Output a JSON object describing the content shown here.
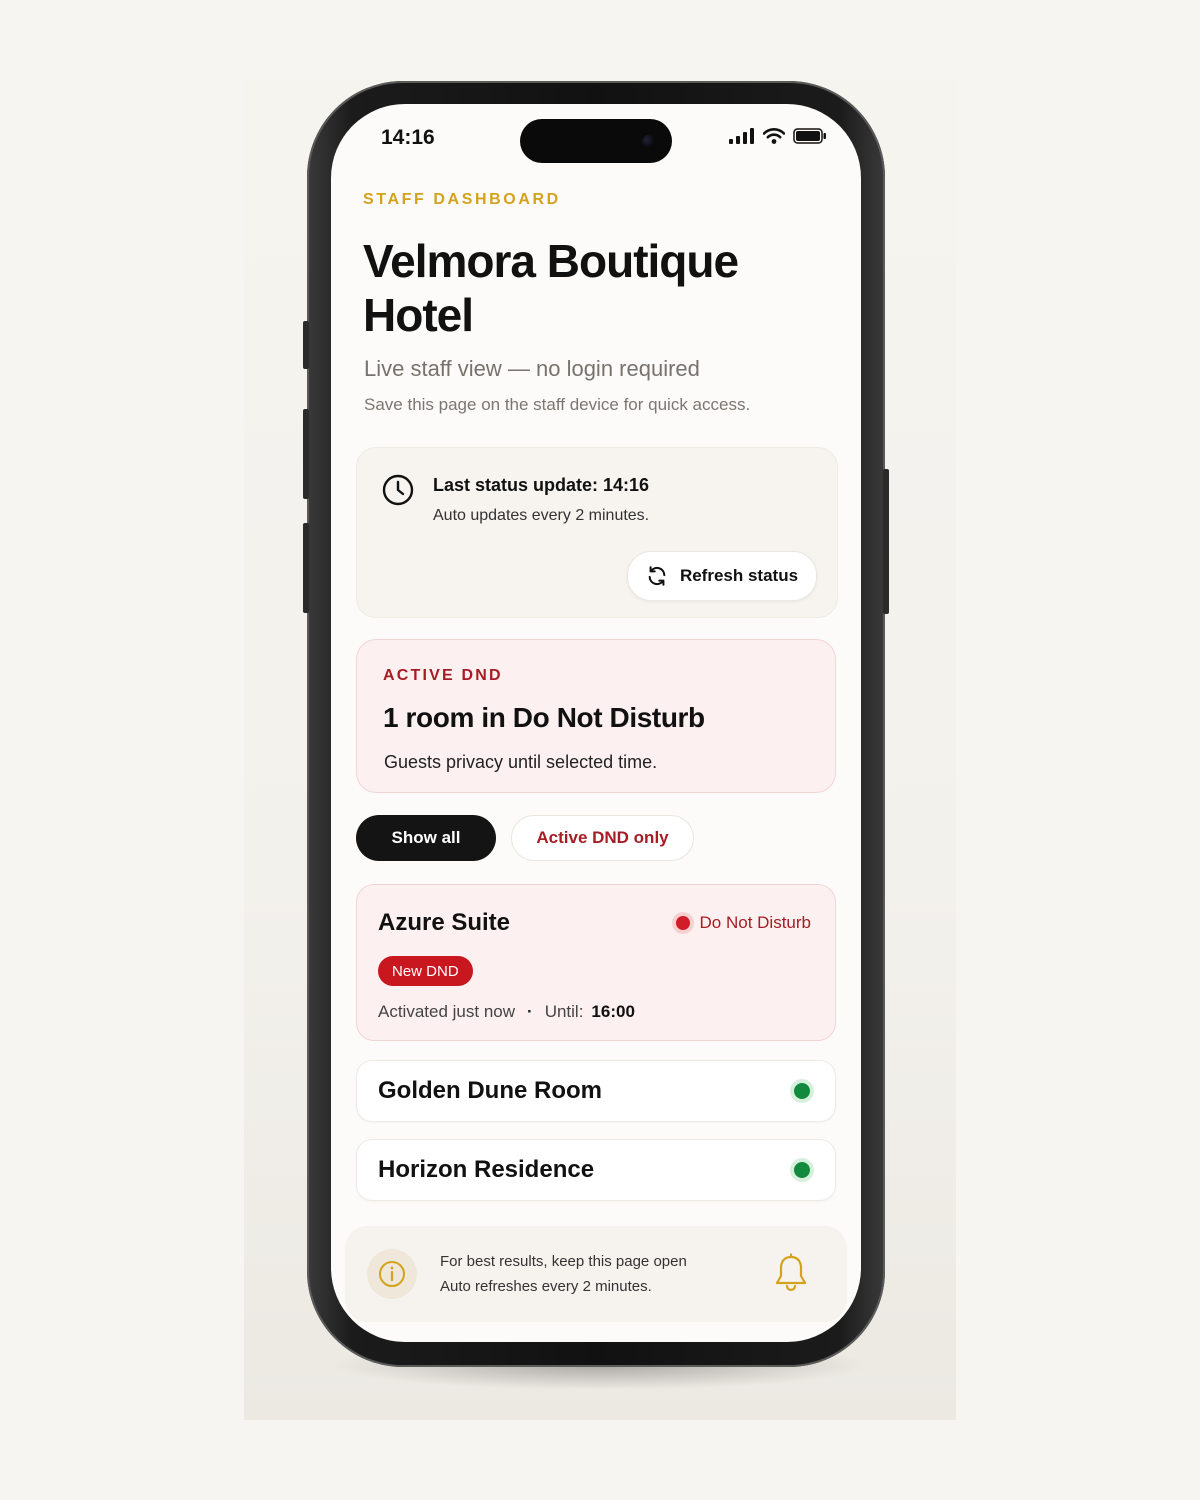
{
  "status_bar": {
    "time": "14:16"
  },
  "header": {
    "eyebrow": "STAFF DASHBOARD",
    "title": "Velmora Boutique Hotel",
    "subtitle": "Live staff view — no login required",
    "note": "Save this page on the staff device for quick access."
  },
  "status_card": {
    "icon": "clock-icon",
    "heading": "Last status update: 14:16",
    "subtext": "Auto updates every 2 minutes.",
    "refresh_label": "Refresh status"
  },
  "dnd_summary": {
    "eyebrow": "ACTIVE DND",
    "title": "1 room in Do Not Disturb",
    "subtext": "Guests privacy until selected time."
  },
  "filters": {
    "show_all": "Show all",
    "active_dnd": "Active DND only",
    "selected": "Show all"
  },
  "rooms": [
    {
      "name": "Azure Suite",
      "status": "Do Not Disturb",
      "badge": "New DND",
      "activated": "Activated just now",
      "until_label": "Until:",
      "until_value": "16:00",
      "status_color": "#d11d27"
    },
    {
      "name": "Golden Dune Room",
      "status_color": "#128a3e"
    },
    {
      "name": "Horizon Residence",
      "status_color": "#128a3e"
    }
  ],
  "footer": {
    "line1": "For best results, keep this page open",
    "line2": "Auto refreshes every 2 minutes.",
    "icons": [
      "info-icon",
      "bell-icon"
    ]
  },
  "colors": {
    "accent_gold": "#d4a21c",
    "dnd_red": "#a51d24",
    "available_green": "#128a3e"
  }
}
